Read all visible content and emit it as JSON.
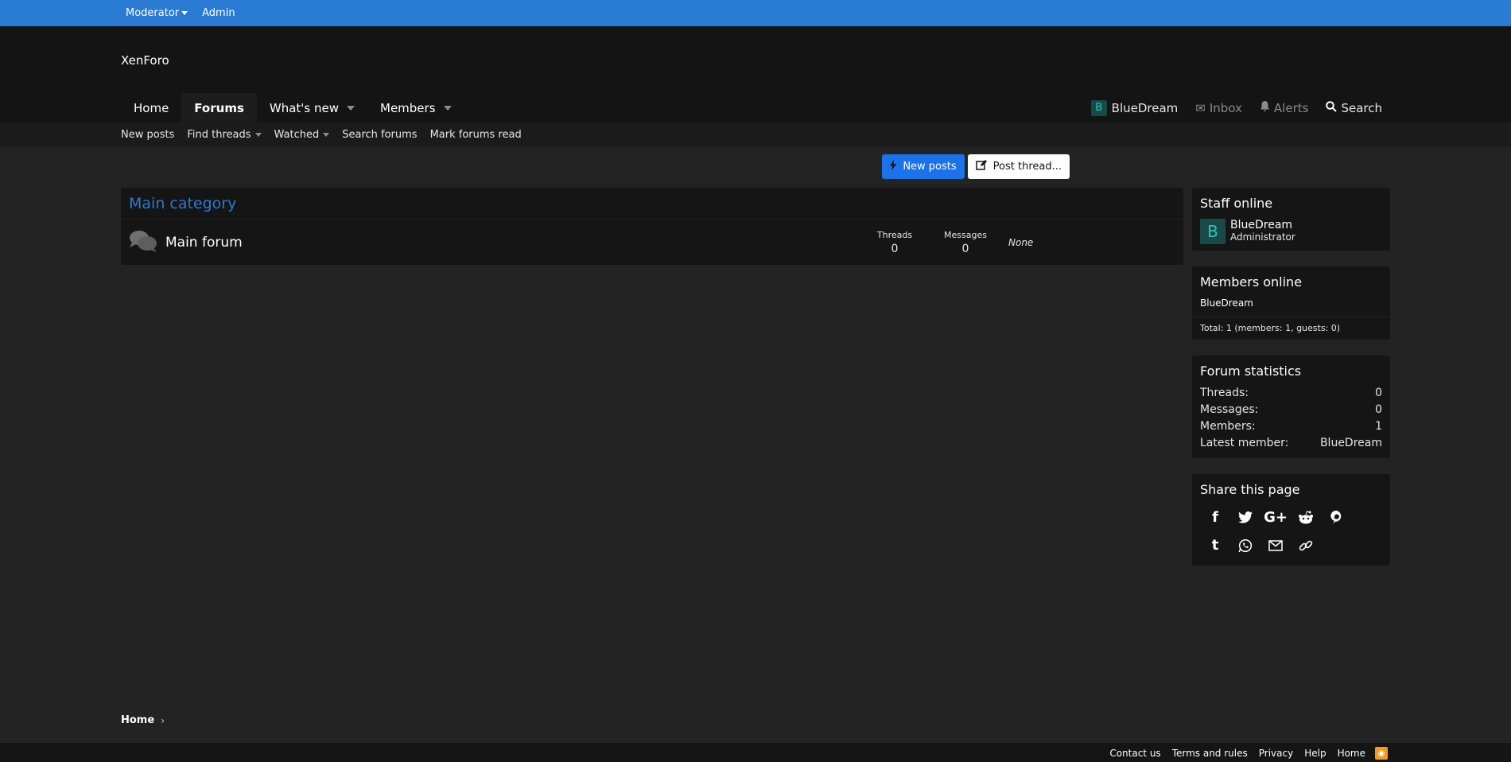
{
  "staff_bar": {
    "moderator": "Moderator",
    "admin": "Admin"
  },
  "header": {
    "logo": "XenForo"
  },
  "nav": {
    "tabs": [
      "Home",
      "Forums",
      "What's new",
      "Members"
    ],
    "user": "BlueDream",
    "user_initial": "B",
    "inbox": "Inbox",
    "alerts": "Alerts",
    "search": "Search"
  },
  "sub_nav": {
    "items": [
      "New posts",
      "Find threads",
      "Watched",
      "Search forums",
      "Mark forums read"
    ]
  },
  "buttons": {
    "new_posts": "New posts",
    "post_thread": "Post thread..."
  },
  "category": {
    "title": "Main category",
    "forum": {
      "title": "Main forum",
      "threads_label": "Threads",
      "threads": "0",
      "messages_label": "Messages",
      "messages": "0",
      "last_post": "None"
    }
  },
  "sidebar": {
    "staff_online": {
      "title": "Staff online",
      "name": "BlueDream",
      "role": "Administrator",
      "initial": "B"
    },
    "members_online": {
      "title": "Members online",
      "list": "BlueDream",
      "total": "Total: 1 (members: 1, guests: 0)"
    },
    "forum_stats": {
      "title": "Forum statistics",
      "rows": [
        {
          "label": "Threads:",
          "value": "0"
        },
        {
          "label": "Messages:",
          "value": "0"
        },
        {
          "label": "Members:",
          "value": "1"
        },
        {
          "label": "Latest member:",
          "value": "BlueDream"
        }
      ]
    },
    "share": {
      "title": "Share this page",
      "icons": [
        "facebook-icon",
        "twitter-icon",
        "google-plus-icon",
        "reddit-icon",
        "pinterest-icon",
        "tumblr-icon",
        "whatsapp-icon",
        "email-icon",
        "link-icon"
      ]
    }
  },
  "breadcrumb": {
    "home": "Home"
  },
  "footer": {
    "links": [
      "Contact us",
      "Terms and rules",
      "Privacy",
      "Help",
      "Home"
    ]
  },
  "colors": {
    "accent": "#2a7bd4",
    "button_blue": "#1a73e8",
    "rss": "#f29b1d"
  }
}
